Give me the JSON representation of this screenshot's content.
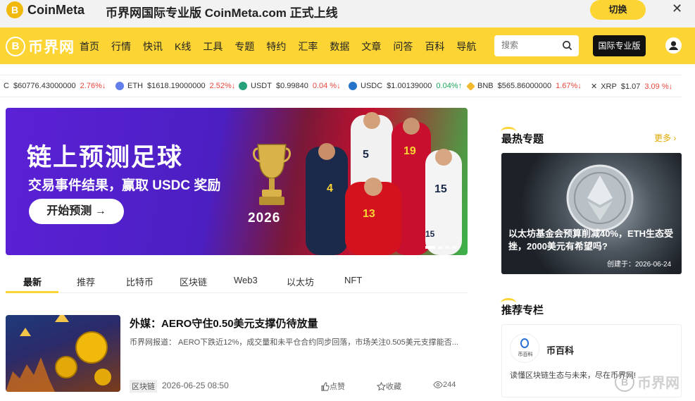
{
  "topbar": {
    "logo_glyph": "B",
    "logo_text": "CoinMeta",
    "promo": "币界网国际专业版 CoinMeta.com 正式上线",
    "switch_label": "切换",
    "close_glyph": "✕"
  },
  "nav": {
    "brand_glyph": "B",
    "brand_text": "币界网",
    "items": [
      "首页",
      "行情",
      "快讯",
      "K线",
      "工具",
      "专题",
      "特约",
      "汇率",
      "数据",
      "文章",
      "问答",
      "百科",
      "导航"
    ],
    "search_placeholder": "搜索",
    "pro_label": "国际专业版"
  },
  "ticker": [
    {
      "symbol": "C",
      "price": "$60776.43000000",
      "change": "2.76%↓",
      "color": "#f7931a",
      "dir": "down"
    },
    {
      "symbol": "ETH",
      "price": "$1618.19000000",
      "change": "2.52%↓",
      "color": "#627eea",
      "dir": "down"
    },
    {
      "symbol": "USDT",
      "price": "$0.99840",
      "change": "0.04 %↓",
      "color": "#26a17b",
      "dir": "down"
    },
    {
      "symbol": "USDC",
      "price": "$1.00139000",
      "change": "0.04%↑",
      "color": "#2775ca",
      "dir": "up"
    },
    {
      "symbol": "BNB",
      "price": "$565.86000000",
      "change": "1.67%↓",
      "color": "#f3ba2f",
      "dir": "down"
    },
    {
      "symbol": "XRP",
      "price": "$1.07",
      "change": "3.09 %↓",
      "color": "#23292f",
      "dir": "down"
    }
  ],
  "banner": {
    "headline": "链上预测足球",
    "subline": "交易事件结果，赢取 USDC 奖励",
    "cta": "开始预测 →",
    "year": "2026",
    "jersey_numbers": [
      "5",
      "19",
      "4",
      "13",
      "15",
      "15"
    ]
  },
  "tabs": [
    "最新",
    "推荐",
    "比特币",
    "区块链",
    "Web3",
    "以太坊",
    "NFT"
  ],
  "article": {
    "title": "外媒：AERO守住0.50美元支撑仍待放量",
    "summary": "币界网报道： AERO下跌近12%，成交量和未平仓合约同步回落，市场关注0.505美元支撑能否...",
    "tag": "区块链",
    "date": "2026-06-25 08:50",
    "like_label": "点赞",
    "fav_label": "收藏",
    "views": "244"
  },
  "sidebar": {
    "hot_title": "最热专题",
    "more": "更多",
    "hot_card_title": "以太坊基金会预算削减40%，ETH生态受挫，2000美元有希望吗?",
    "hot_card_date": "创建于：2026-06-24",
    "column_title": "推荐专栏",
    "column_name": "币百科",
    "column_avatar_text": "币百科",
    "column_desc": "读懂区块链生态与未来，尽在币界网!"
  },
  "watermark": {
    "glyph": "B",
    "text": "币界网"
  },
  "colors": {
    "brand_yellow": "#fcd535",
    "down_red": "#e8453c",
    "up_green": "#1aa55b"
  }
}
